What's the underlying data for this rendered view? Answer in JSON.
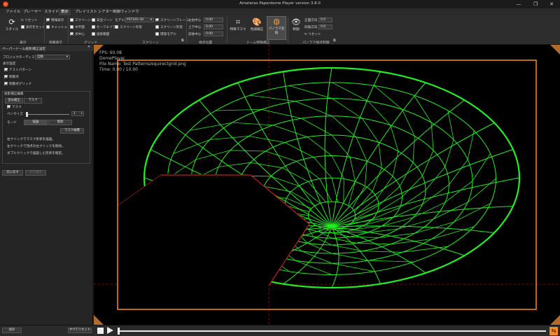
{
  "window": {
    "title": "Amateras Paperdome Player version 3.8.0",
    "minimize": "—",
    "maximize": "❐",
    "close": "✕"
  },
  "menu": {
    "items": [
      "ファイル",
      "プレーヤー",
      "スライド",
      "表示",
      "プレイリスト",
      "シアター制御",
      "ウィンドウ"
    ],
    "active_index": 3
  },
  "ribbon": {
    "style": {
      "label": "スタイル"
    },
    "style_group": {
      "reset": "リセット",
      "save_display": "表示をセット",
      "label": "表示"
    },
    "info": {
      "info_display": "情報表示",
      "cache": "キャッシュ",
      "label": "情報表示"
    },
    "grid": {
      "screen": "スクリーン",
      "horizontal": "水平面",
      "dot_center": "点中心",
      "label": "グリッド"
    },
    "grid2": {
      "safe_zone": "安全ゾーン",
      "safe_area": "セーフエリア",
      "projector_range": "投影範囲"
    },
    "model": {
      "label": "モデル",
      "value": "PST165-30",
      "screen_outline": "スクリーン外形"
    },
    "screen": {
      "screen_frame": "スクリーンフレーム",
      "screen_proj": "スクリーン外装",
      "env_model": "環境モデル",
      "label": "スクリーン"
    },
    "view": {
      "h_center": "左右中心",
      "h_value": "0.00",
      "v_center": "上下中心",
      "v_value": "0.00",
      "fwd_center": "前後中心",
      "fwd_value": "0.00",
      "label": "視点位置"
    },
    "dome": {
      "crop_mask": "特殊マスク",
      "color_correct": "色調補正",
      "panorama": "パノラマ変換",
      "label": "ドーム特殊補正"
    },
    "pano": {
      "control": "制御",
      "yaw_label": "正面方向",
      "yaw": "0.0",
      "pitch_label": "仰角方向",
      "pitch": "0.0",
      "reset": "リセット",
      "label": "パノラマ視点制御"
    }
  },
  "left_panel": {
    "title": "ペーパードーム投影補正設定",
    "close": "✕",
    "projector_display_label": "プロジェクターディスプレイ",
    "projector_display_value": "自動",
    "display_settings": "表示設定",
    "test_pattern": "テストパターン",
    "control_point": "制御点",
    "control_grid": "制御点グリッド",
    "shape_correct": "投影補正編集",
    "tab_distort": "歪み補正",
    "tab_mask": "マスク",
    "mask_checkbox": "マスク",
    "pen_size_label": "ペンサイズ",
    "pen_size_value": "1",
    "mode_label": "モード",
    "mode_draw": "描画",
    "mode_erase": "削除",
    "mask_clear": "マスク破棄",
    "help1": "右クリックでマスク形状を描画。",
    "help2": "左クリックで頂点の左クリックを削除。",
    "help3": "ダブルクリックで描画した形状を確定。",
    "undo": "元に戻す",
    "redo": "やり直す",
    "save": "保存",
    "reset_all": "すべてリセット"
  },
  "overlay": {
    "fps": "FPS: 60.08",
    "player": "DomePlayer",
    "file": "File Name: Test Patterns/equirectgrid.png",
    "time": "Time: 0.00 / 10.00"
  },
  "colors": {
    "grid": "#22ee22",
    "border": "#ff8c1a",
    "mask_outline": "#c0201c",
    "guide": "#a01010"
  },
  "playback": {
    "progress": 0.0
  }
}
